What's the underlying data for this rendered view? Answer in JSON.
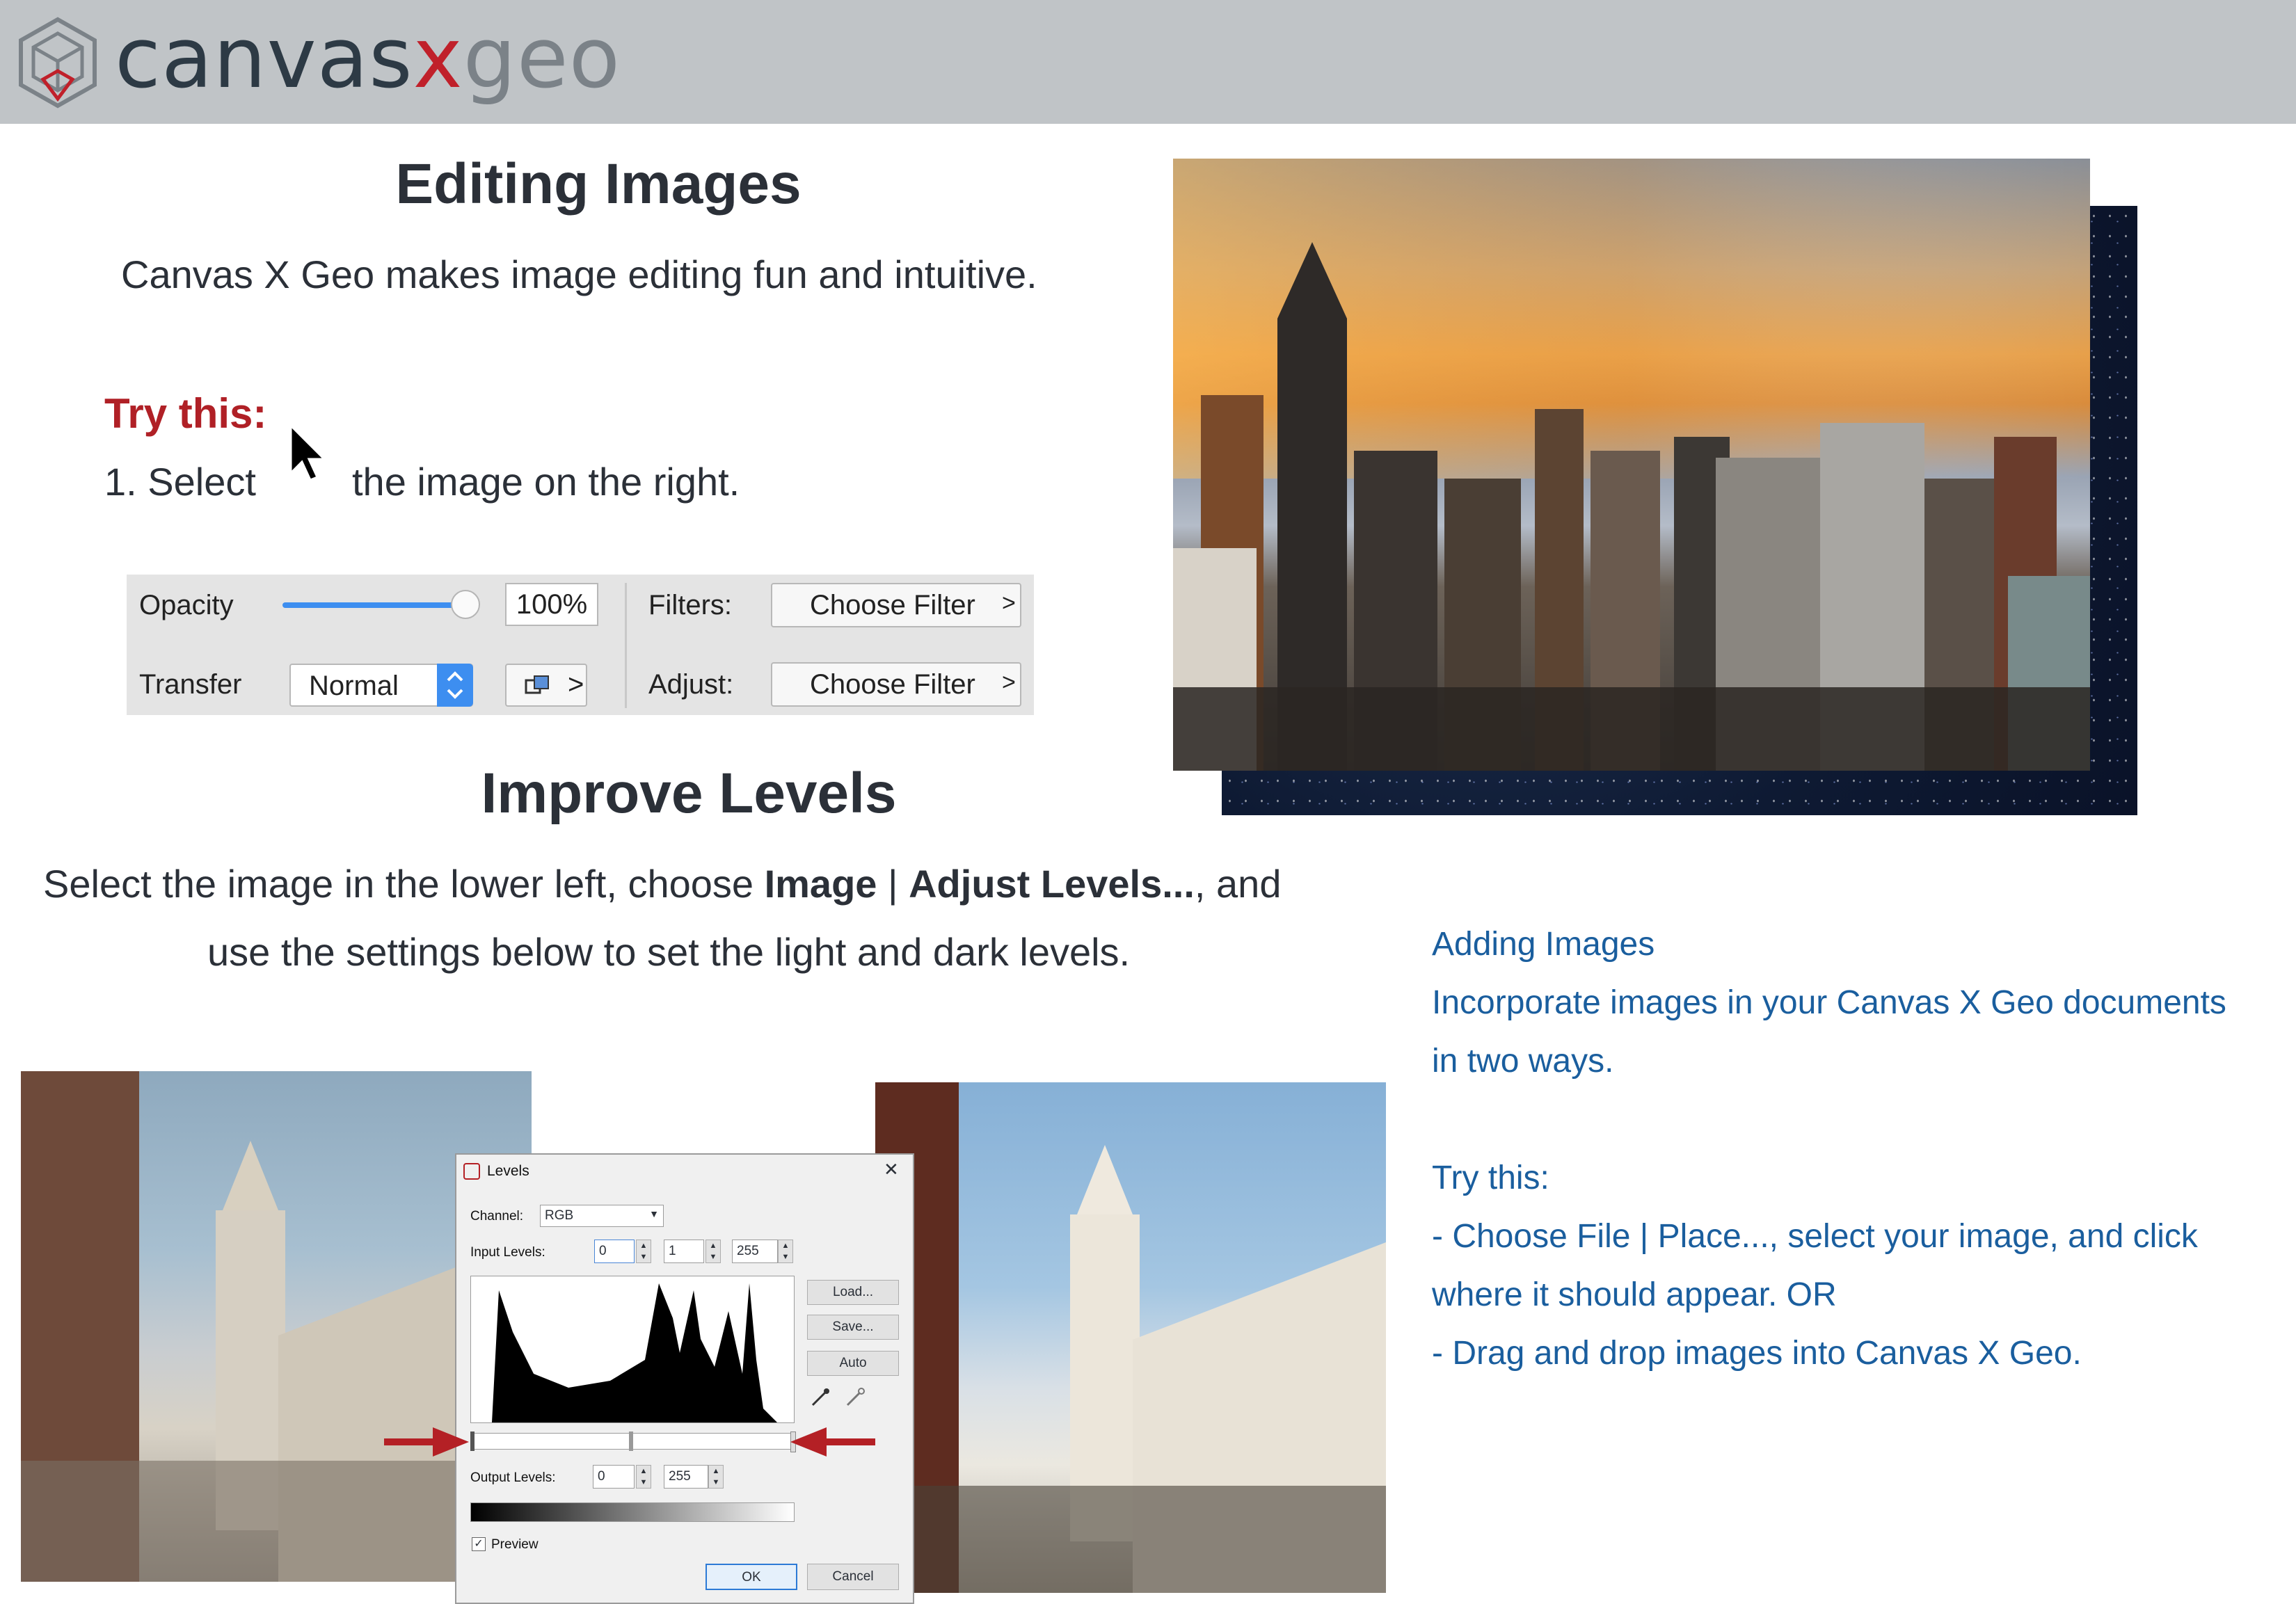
{
  "header": {
    "brand_part1": "canvas",
    "brand_part2": "x",
    "brand_part3": "geo",
    "logo_icon": "canvas-x-cube-logo"
  },
  "editing": {
    "title": "Editing Images",
    "subtitle": "Canvas X Geo makes image editing fun and intuitive.",
    "try_label": "Try this:",
    "step1_before": "1. Select",
    "step1_after": "the image on the right.",
    "cursor_icon": "arrow-cursor-icon"
  },
  "toolbar": {
    "opacity_label": "Opacity",
    "opacity_value": "100%",
    "opacity_level": 1.0,
    "transfer_label": "Transfer",
    "transfer_value": "Normal",
    "filters_label": "Filters:",
    "filters_button": "Choose Filter",
    "adjust_label": "Adjust:",
    "adjust_button": "Choose Filter",
    "chevron": ">",
    "accent_color": "#3d8ef0"
  },
  "levels_section": {
    "title": "Improve Levels",
    "line1_a": "Select the image in the lower left, choose ",
    "line1_b": "Image",
    "line1_c": " | ",
    "line1_d": "Adjust Levels...",
    "line1_e": ", and",
    "line2": "use the settings below to set the light and dark levels."
  },
  "levels_dialog": {
    "title": "Levels",
    "channel_label": "Channel:",
    "channel_value": "RGB",
    "input_label": "Input Levels:",
    "input_black": "0",
    "input_gamma": "1",
    "input_white": "255",
    "output_label": "Output Levels:",
    "output_black": "0",
    "output_white": "255",
    "load_button": "Load...",
    "save_button": "Save...",
    "auto_button": "Auto",
    "preview_label": "Preview",
    "ok_button": "OK",
    "cancel_button": "Cancel",
    "close_glyph": "✕",
    "arrow_color": "#b42025"
  },
  "adding": {
    "title": "Adding Images",
    "line1": "Incorporate images in your Canvas X Geo documents",
    "line2": "in two ways.",
    "try_label": "Try this:",
    "bullet1a": "- Choose File | Place..., select your image, and click",
    "bullet1b": "where it should appear. OR",
    "bullet2": "- Drag and drop images into Canvas X Geo."
  },
  "colors": {
    "header_bg": "#c0c4c7",
    "brand_dark": "#2d3a45",
    "brand_red": "#c0202a",
    "brand_grey": "#7b8288",
    "try_red": "#b02026",
    "link_blue": "#1a5e9e"
  }
}
